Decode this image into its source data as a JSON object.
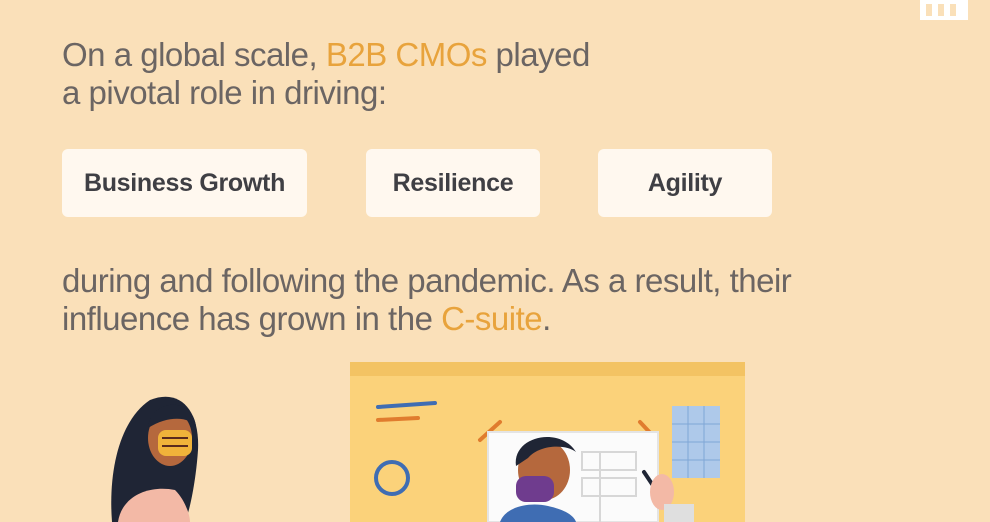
{
  "intro": {
    "line1_before": "On a global scale, ",
    "line1_highlight": "B2B CMOs",
    "line1_after": " played",
    "line2": "a pivotal role in driving:"
  },
  "drivers": [
    {
      "label": "Business Growth"
    },
    {
      "label": "Resilience"
    },
    {
      "label": "Agility"
    }
  ],
  "outro": {
    "line1": "during and following the pandemic. As a result, their",
    "line2_before": "influence has grown in the ",
    "line2_highlight": "C-suite",
    "line2_after": "."
  },
  "colors": {
    "background": "#fae0b9",
    "accent": "#e8a33c",
    "body_text": "#6b6563",
    "pill_bg": "#fff8ef",
    "pill_text": "#3f3f44"
  },
  "icons": [
    "grid-icon"
  ]
}
